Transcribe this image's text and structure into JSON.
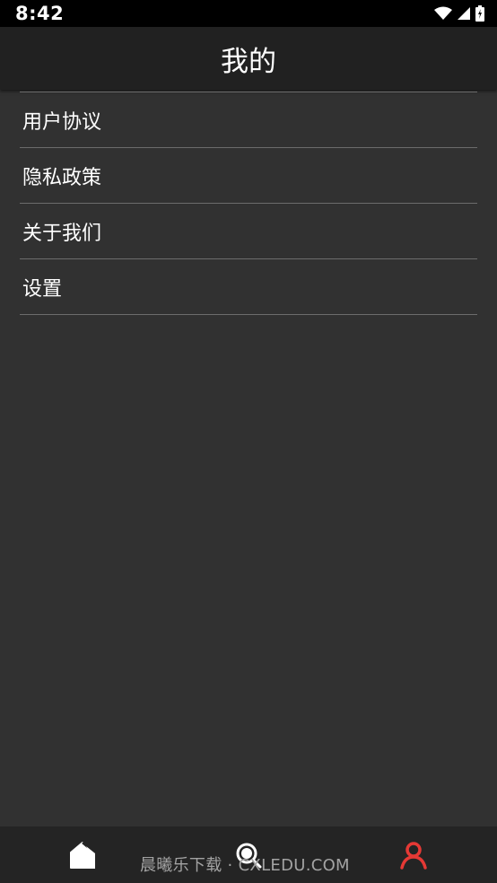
{
  "status_bar": {
    "time": "8:42",
    "icons": [
      "wifi-icon",
      "signal-icon",
      "battery-icon"
    ]
  },
  "app_bar": {
    "title": "我的"
  },
  "menu": {
    "items": [
      {
        "label": "用户协议"
      },
      {
        "label": "隐私政策"
      },
      {
        "label": "关于我们"
      },
      {
        "label": "设置"
      }
    ]
  },
  "bottom_nav": {
    "items": [
      {
        "icon": "home-icon",
        "active": false
      },
      {
        "icon": "search-icon",
        "active": false
      },
      {
        "icon": "profile-icon",
        "active": true
      }
    ],
    "active_color": "#e53935",
    "inactive_color": "#ffffff"
  },
  "watermark": {
    "text": "晨曦乐下载 · CXLEDU.COM"
  },
  "colors": {
    "background": "#313131",
    "app_bar": "#212121",
    "status_bar": "#000000",
    "divider": "#6c6c6c",
    "nav_bar": "#242424"
  }
}
